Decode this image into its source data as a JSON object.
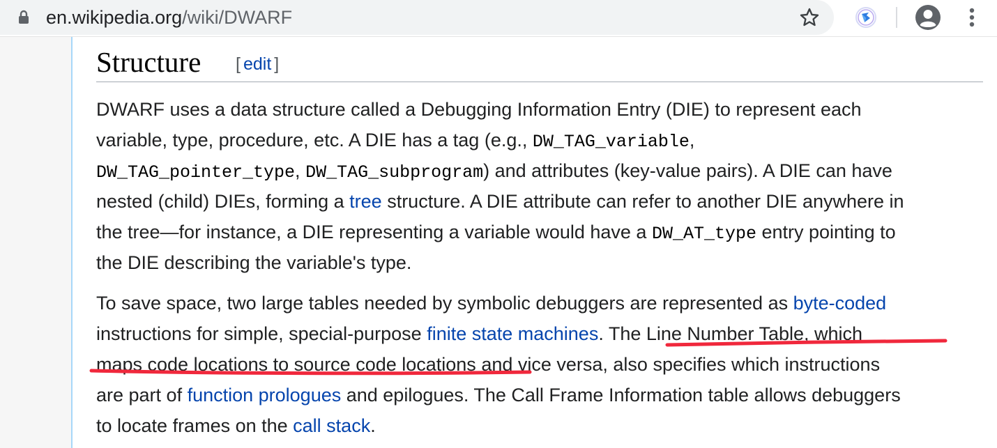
{
  "browser": {
    "url_host": "en.wikipedia.org",
    "url_path": "/wiki/DWARF",
    "icons": [
      "lock-icon",
      "star-icon",
      "extension-icon",
      "profile-avatar-icon",
      "more-menu-icon"
    ],
    "accent_color": "#5f6368"
  },
  "article": {
    "section_title": "Structure",
    "edit_open": "[",
    "edit_label": "edit",
    "edit_close": "]",
    "link_color": "#0645ad",
    "p1": {
      "l1": "DWARF uses a data structure called a Debugging Information Entry (DIE) to represent each",
      "l2a": "variable, type, procedure, etc. A DIE has a tag (e.g., ",
      "code1": "DW_TAG_variable",
      "l2b": ",",
      "code2": "DW_TAG_pointer_type",
      "l3a": ", ",
      "code3": "DW_TAG_subprogram",
      "l3b": ") and attributes (key-value pairs). A DIE can have",
      "l4a": "nested (child) DIEs, forming a ",
      "link_tree": "tree",
      "l4b": " structure. A DIE attribute can refer to another DIE anywhere in",
      "l5a": "the tree—for instance, a DIE representing a variable would have a ",
      "code4": "DW_AT_type",
      "l5b": " entry pointing to",
      "l6": "the DIE describing the variable's type."
    },
    "p2": {
      "l1a": "To save space, two large tables needed by symbolic debuggers are represented as ",
      "link_bytecoded": "byte-coded",
      "l2a": "instructions for simple, special-purpose ",
      "link_fsm": "finite state machines",
      "l2b": ". The Line Number Table, which",
      "l3": "maps code locations to source code locations and vice versa, also specifies which instructions",
      "l4a": "are part of ",
      "link_prologues": "function prologues",
      "l4b": " and epilogues. The Call Frame Information table allows debuggers",
      "l5a": "to locate frames on the ",
      "link_callstack": "call stack",
      "l5b": "."
    },
    "annotation_color": "#f0283c"
  }
}
